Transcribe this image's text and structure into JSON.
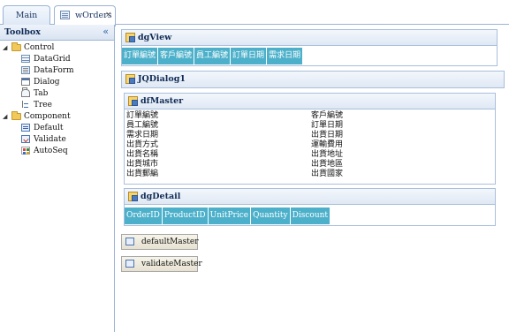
{
  "tabs": [
    {
      "label": "Main"
    },
    {
      "label": "wOrders",
      "close": "×"
    }
  ],
  "toolbox": {
    "title": "Toolbox",
    "collapse_glyph": "«",
    "groups": [
      {
        "label": "Control",
        "expand_glyph": "◢",
        "items": [
          "DataGrid",
          "DataForm",
          "Dialog",
          "Tab",
          "Tree"
        ]
      },
      {
        "label": "Component",
        "expand_glyph": "◢",
        "items": [
          "Default",
          "Validate",
          "AutoSeq"
        ]
      }
    ]
  },
  "dgView": {
    "title": "dgView",
    "columns": [
      "訂單編號",
      "客戶編號",
      "員工編號",
      "訂單日期",
      "需求日期"
    ]
  },
  "dialog": {
    "title": "JQDialog1"
  },
  "dfMaster": {
    "title": "dfMaster",
    "left_fields": [
      "訂單編號",
      "員工編號",
      "需求日期",
      "出貨方式",
      "出貨名稱",
      "出貨城市",
      "出貨郵編"
    ],
    "right_fields": [
      "客戶編號",
      "訂單日期",
      "出貨日期",
      "運輸費用",
      "出貨地址",
      "出貨地區",
      "出貨國家"
    ]
  },
  "dgDetail": {
    "title": "dgDetail",
    "columns": [
      "OrderID",
      "ProductID",
      "UnitPrice",
      "Quantity",
      "Discount"
    ]
  },
  "components": {
    "default": "defaultMaster",
    "validate": "validateMaster"
  }
}
